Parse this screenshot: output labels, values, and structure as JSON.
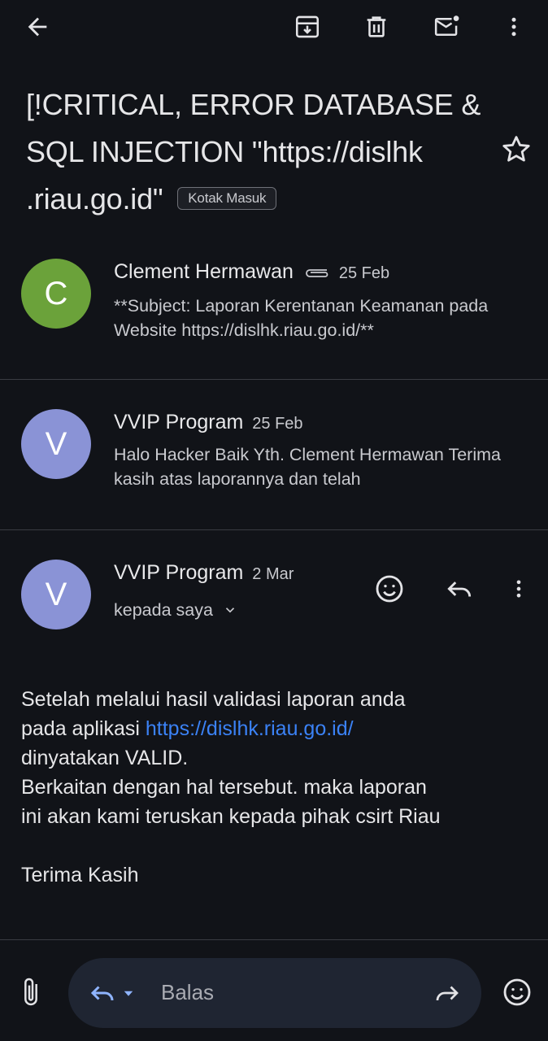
{
  "toolbar": {
    "icons": [
      "back-arrow-icon",
      "archive-icon",
      "delete-icon",
      "mark-unread-icon",
      "more-vert-icon"
    ]
  },
  "email": {
    "subject": "[!CRITICAL, ERROR DATABASE & SQL INJECTION \"https://dislhk .riau.go.id\"",
    "label": "Kotak Masuk"
  },
  "messages": [
    {
      "avatar_letter": "C",
      "avatar_color": "#6ba23a",
      "sender": "Clement Hermawan",
      "has_attachment": true,
      "date": "25 Feb",
      "snippet": "**Subject: Laporan Kerentanan Keamanan pada Website https://dislhk.riau.go.id/**"
    },
    {
      "avatar_letter": "V",
      "avatar_color": "#8a93d6",
      "sender": "VVIP Program",
      "date": "25 Feb",
      "snippet": "Halo Hacker Baik Yth. Clement Hermawan Terima kasih atas laporannya dan telah"
    },
    {
      "avatar_letter": "V",
      "avatar_color": "#8a93d6",
      "sender": "VVIP Program",
      "date": "2 Mar",
      "recipient": "kepada saya"
    }
  ],
  "body": {
    "line1": "Setelah melalui hasil validasi laporan anda",
    "line2_prefix": "pada aplikasi ",
    "link": "https://dislhk.riau.go.id/",
    "line3": "dinyatakan VALID.",
    "line4": "Berkaitan dengan hal tersebut. maka laporan",
    "line5": "ini akan kami teruskan kepada pihak csirt Riau",
    "closing": "Terima Kasih"
  },
  "reply_bar": {
    "placeholder": "Balas"
  },
  "colors": {
    "background": "#111318",
    "link": "#3b82f6",
    "reply_pill": "#1f2532"
  }
}
